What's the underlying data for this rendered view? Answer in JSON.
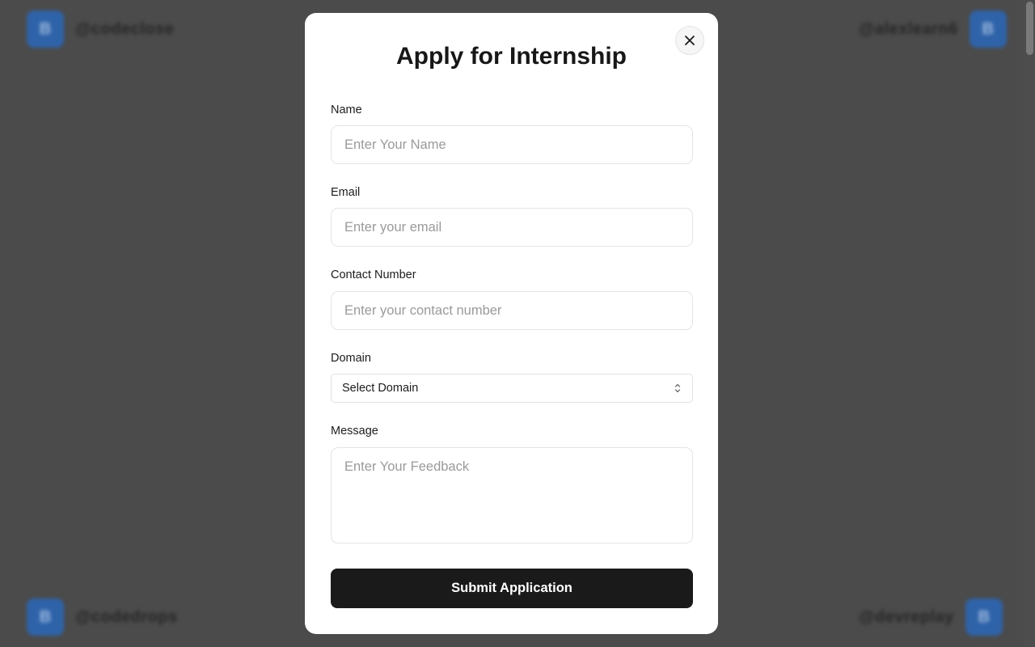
{
  "colors": {
    "overlay": "#4b4b4b",
    "modal_bg": "#ffffff",
    "title": "#171717",
    "button_bg": "#1a1a1a",
    "button_text": "#ffffff",
    "avatar": "#2f63a9"
  },
  "background": {
    "users": [
      {
        "avatar_letter": "B",
        "handle": "@codeclose"
      },
      {
        "avatar_letter": "B",
        "handle": "@alexlearn6"
      },
      {
        "avatar_letter": "B",
        "handle": "@codedrops"
      },
      {
        "avatar_letter": "B",
        "handle": "@devreplay"
      }
    ]
  },
  "modal": {
    "title": "Apply for Internship",
    "close_icon": "close-icon",
    "fields": {
      "name": {
        "label": "Name",
        "placeholder": "Enter Your Name",
        "value": ""
      },
      "email": {
        "label": "Email",
        "placeholder": "Enter your email",
        "value": ""
      },
      "contact": {
        "label": "Contact Number",
        "placeholder": "Enter your contact number",
        "value": ""
      },
      "domain": {
        "label": "Domain",
        "selected": "Select Domain",
        "icon": "chevron-up-down-icon"
      },
      "message": {
        "label": "Message",
        "placeholder": "Enter Your Feedback",
        "value": ""
      }
    },
    "submit_label": "Submit Application"
  }
}
